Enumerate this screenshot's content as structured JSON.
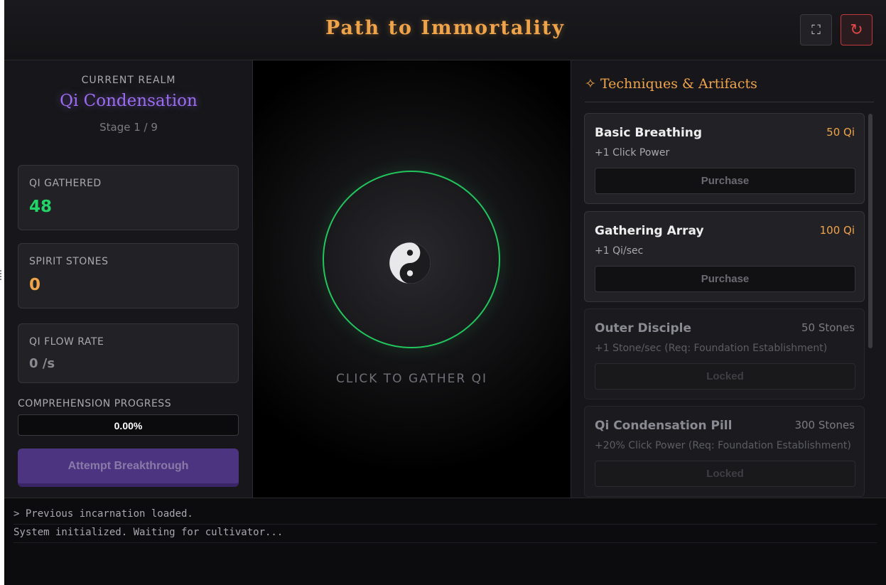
{
  "header": {
    "title": "Path to Immortality",
    "fullscreen_icon": "⛶",
    "reset_icon": "↻"
  },
  "realm": {
    "label": "CURRENT REALM",
    "name": "Qi Condensation",
    "stage": "Stage 1 / 9"
  },
  "stats": {
    "qi": {
      "label": "QI GATHERED",
      "value": "48"
    },
    "stones": {
      "label": "SPIRIT STONES",
      "value": "0"
    },
    "flow": {
      "label": "QI FLOW RATE",
      "value": "0 /s"
    }
  },
  "progress": {
    "label": "COMPREHENSION PROGRESS",
    "text": "0.00%",
    "fraction": 0.0
  },
  "breakthrough_label": "Attempt Breakthrough",
  "center": {
    "gather_text": "CLICK TO GATHER QI",
    "orb_icon": "yin-yang-icon"
  },
  "shop": {
    "title": "✧ Techniques & Artifacts",
    "items": [
      {
        "name": "Basic Breathing",
        "cost": "50 Qi",
        "desc": "+1 Click Power",
        "button": "Purchase"
      },
      {
        "name": "Gathering Array",
        "cost": "100 Qi",
        "desc": "+1 Qi/sec",
        "button": "Purchase"
      },
      {
        "name": "Outer Disciple",
        "cost": "50 Stones",
        "desc": "+1 Stone/sec (Req: Foundation Establishment)",
        "button": "Locked"
      },
      {
        "name": "Qi Condensation Pill",
        "cost": "300 Stones",
        "desc": "+20% Click Power (Req: Foundation Establishment)",
        "button": "Locked"
      }
    ]
  },
  "log": [
    "> Previous incarnation loaded.",
    "System initialized. Waiting for cultivator..."
  ],
  "colors": {
    "accent": "#f0a44a",
    "realm": "#9b6cf0",
    "qi": "#22d468",
    "orb_ring": "#22c55e",
    "reset": "#e04848"
  }
}
